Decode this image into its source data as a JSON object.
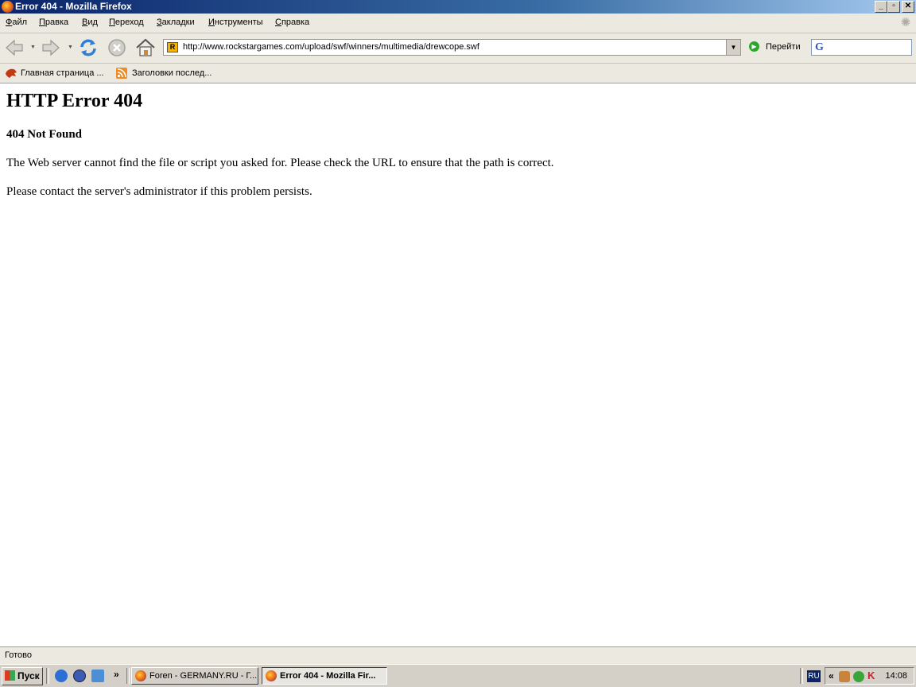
{
  "window": {
    "title": "Error 404 - Mozilla Firefox",
    "controls": {
      "minimize": "_",
      "restore": "▫",
      "close": "✕"
    }
  },
  "menu": {
    "items": [
      {
        "first": "Ф",
        "rest": "айл"
      },
      {
        "first": "П",
        "rest": "равка"
      },
      {
        "first": "В",
        "rest": "ид"
      },
      {
        "first": "П",
        "rest": "ереход"
      },
      {
        "first": "З",
        "rest": "акладки"
      },
      {
        "first": "И",
        "rest": "нструменты"
      },
      {
        "first": "С",
        "rest": "правка"
      }
    ]
  },
  "toolbar": {
    "url": "http://www.rockstargames.com/upload/swf/winners/multimedia/drewcope.swf",
    "site_icon": "R",
    "go_label": "Перейти",
    "search_engine_icon": "G"
  },
  "bookmarks": {
    "items": [
      {
        "label": "Главная страница ...",
        "icon": "firefox-home-icon"
      },
      {
        "label": "Заголовки послед...",
        "icon": "rss-feed-icon"
      }
    ]
  },
  "page": {
    "heading": "HTTP Error 404",
    "subheading": "404 Not Found",
    "paragraph1": "The Web server cannot find the file or script you asked for. Please check the URL to ensure that the path is correct.",
    "paragraph2": "Please contact the server's administrator if this problem persists."
  },
  "status": {
    "text": "Готово"
  },
  "taskbar": {
    "start_label": "Пуск",
    "more_label": "»",
    "tasks": [
      {
        "label": "Foren - GERMANY.RU - Г...",
        "active": false
      },
      {
        "label": "Error 404 - Mozilla Fir...",
        "active": true
      }
    ],
    "language": "RU",
    "tray_expand": "«",
    "clock": "14:08"
  },
  "colors": {
    "titlebar_start": "#0a246a",
    "titlebar_end": "#a6caf0",
    "chrome_bg": "#ece9e1",
    "taskbar_bg": "#d4d0c8"
  }
}
